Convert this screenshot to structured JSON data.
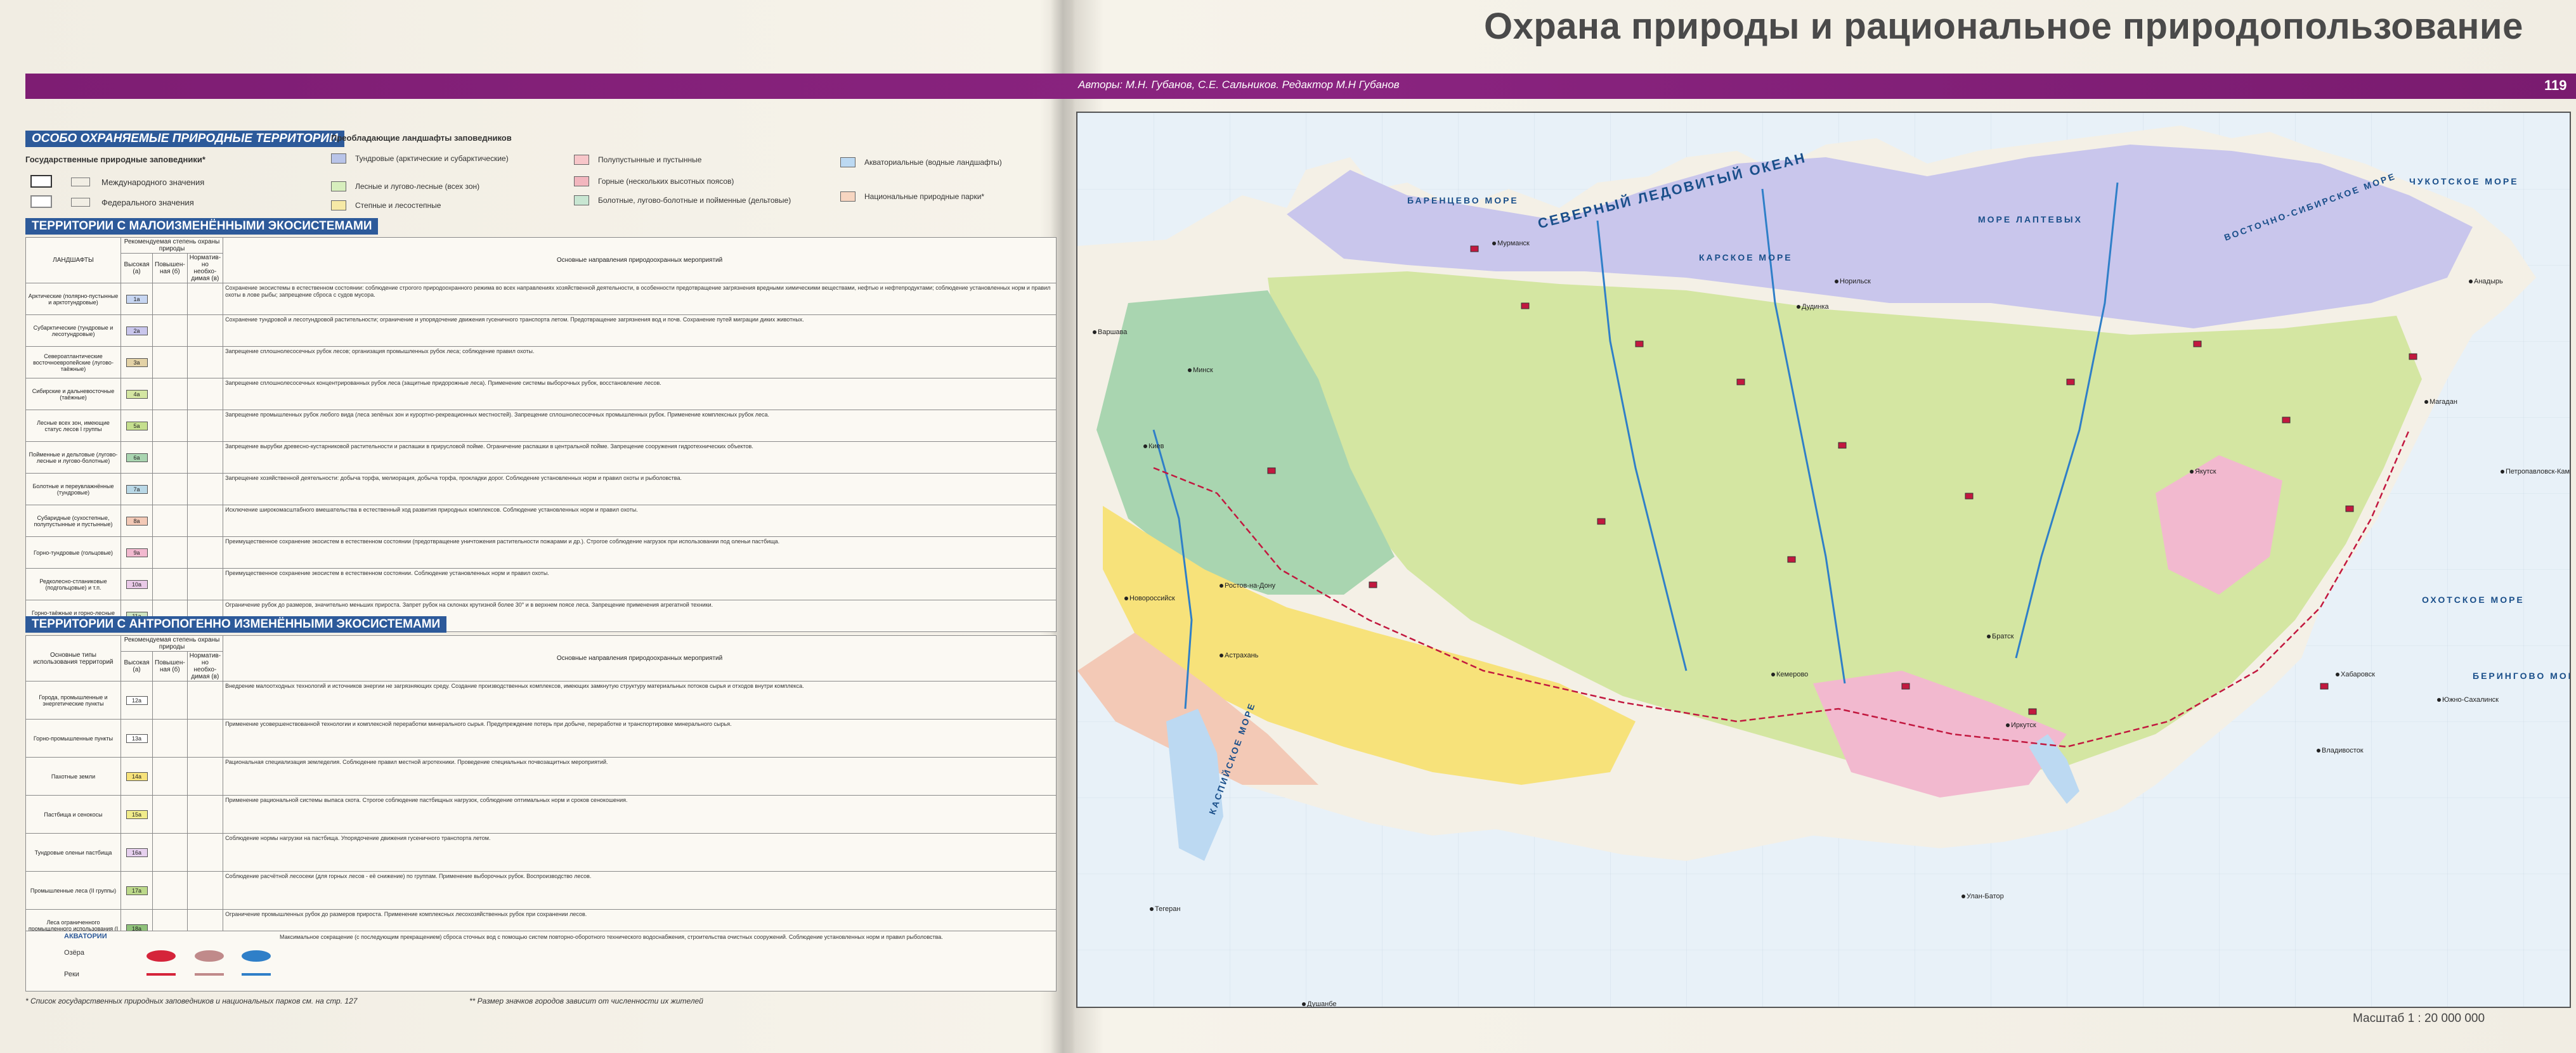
{
  "page": {
    "title": "Охрана природы и рациональное природопользование",
    "authors": "Авторы:  М.Н. Губанов, С.Е. Сальников.   Редактор  М.Н Губанов",
    "page_number": "119",
    "scale": "Масштаб   1 : 20 000 000"
  },
  "legend": {
    "sec_protected": "ОСОБО ОХРАНЯЕМЫЕ ПРИРОДНЫЕ ТЕРРИТОРИИ",
    "reserves_label": "Государственные природные заповедники*",
    "international": "Международного значения",
    "federal": "Федерального значения",
    "landscapes_head": "Преобладающие ландшафты заповедников",
    "landscape_items": [
      {
        "label": "Тундровые (арктические и субарктические)",
        "color": "#b9c4e8"
      },
      {
        "label": "Лесные и лугово-лесные (всех зон)",
        "color": "#d7eebd"
      },
      {
        "label": "Степные и лесостепные",
        "color": "#f6e9a6"
      },
      {
        "label": "Полупустынные и пустынные",
        "color": "#f7c6c9"
      },
      {
        "label": "Горные (нескольких высотных поясов)",
        "color": "#f2b6be"
      },
      {
        "label": "Болотные, лугово-болотные и пойменные (дельтовые)",
        "color": "#c8e6d2"
      },
      {
        "label": "Акваториальные (водные ландшафты)",
        "color": "#bcd9f2"
      },
      {
        "label": "Национальные природные парки*",
        "color": "#f7d6c1"
      }
    ],
    "sec_low": "ТЕРРИТОРИИ С МАЛОИЗМЕНЁННЫМИ ЭКОСИСТЕМАМИ",
    "t1_cols": [
      "ЛАНДШАФТЫ",
      "Рекомендуемая степень охраны природы",
      "Высокая (а)",
      "Повышен-ная (б)",
      "Норматив-но необхо-димая (в)",
      "Основные направления природоохранных мероприятий"
    ],
    "t1_rows": [
      {
        "name": "Арктические (полярно-пустынные и арктотундровые)",
        "code": "1а",
        "color": "#c7d6f2",
        "desc": "Сохранение экосистемы в естественном состоянии: соблюдение строгого природоохранного режима во всех направлениях хозяйственной деятельности, в особенности предотвращение загрязнения вредными химическими веществами, нефтью и нефтепродуктами; соблюдение установленных норм и правил охоты в лове рыбы; запрещение сброса с судов мусора."
      },
      {
        "name": "Субарктические (тундровые и лесотундровые)",
        "code": "2а",
        "color": "#c9c6ec",
        "desc": "Сохранение тундровой и лесотундровой растительности; ограничение и упорядочение движения гусеничного транспорта летом. Предотвращение загрязнения вод и почв. Сохранение путей миграции диких животных."
      },
      {
        "name": "Североатлантические восточноевропейские (лугово-таёжные)",
        "code": "3а",
        "color": "#e3d2a6",
        "desc": "Запрещение сплошнолесосечных рубок лесов; организация промышленных рубок леса; соблюдение правил охоты."
      },
      {
        "name": "Сибирские и дальневосточные (таёжные)",
        "code": "4а",
        "color": "#d4e6a2",
        "desc": "Запрещение сплошнолесосечных концентрированных рубок леса (защитные придорожные леса). Применение системы выборочных рубок, восстановление лесов."
      },
      {
        "name": "Лесные всех зон, имеющие статус лесов I группы",
        "code": "5а",
        "color": "#c5df8e",
        "desc": "Запрещение промышленных рубок любого вида (леса зелёных зон и курортно-рекреационных местностей). Запрещение сплошнолесосечных промышленных рубок. Применение комплексных рубок леса."
      },
      {
        "name": "Пойменные и дельтовые (лугово-лесные и лугово-болотные)",
        "code": "6а",
        "color": "#a9d5b0",
        "desc": "Запрещение вырубки древесно-кустарниковой растительности и распашки в прирусловой пойме. Ограничение распашки в центральной пойме. Запрещение сооружения гидротехнических объектов."
      },
      {
        "name": "Болотные и переувлажнённые (тундровые)",
        "code": "7а",
        "color": "#b9d8e6",
        "desc": "Запрещение хозяйственной деятельности: добыча торфа, мелиорация, добыча торфа, прокладки дорог. Соблюдение установленных норм и правил охоты и рыболовства."
      },
      {
        "name": "Субаридные (сухостепные, полупустынные и пустынные)",
        "code": "8а",
        "color": "#f3c9b6",
        "desc": "Исключение широкомасштабного вмешательства в естественный ход развития природных комплексов. Соблюдение установленных норм и правил охоты."
      },
      {
        "name": "Горно-тундровые (гольцовые)",
        "code": "9а",
        "color": "#f2b9cf",
        "desc": "Преимущественное сохранение экосистем в естественном состоянии (предотвращение уничтожения растительности пожарами и др.). Строгое соблюдение нагрузок при использовании под оленьи пастбища."
      },
      {
        "name": "Редколесно-стланиковые (подгольцовые) и т.п.",
        "code": "10а",
        "color": "#e9c9e7",
        "desc": "Преимущественное сохранение экосистем в естественном состоянии. Соблюдение установленных норм и правил охоты."
      },
      {
        "name": "Горно-таёжные и горно-лесные всех зон",
        "code": "11а",
        "color": "#cfe4bf",
        "desc": "Ограничение рубок до размеров, значительно меньших прироста. Запрет рубок на склонах крутизной более 30° и в верхнем поясе леса. Запрещение применения агрегатной техники."
      }
    ],
    "sec_anthro": "ТЕРРИТОРИИ С АНТРОПОГЕННО ИЗМЕНЁННЫМИ ЭКОСИСТЕМАМИ",
    "t2_cols": [
      "Основные типы использования территорий",
      "Рекомендуемая степень охраны природы",
      "Высокая (а)",
      "Повышен-ная (б)",
      "Норматив-но необхо-димая (в)",
      "Основные направления природоохранных мероприятий"
    ],
    "t2_rows": [
      {
        "name": "Города, промышленные и энергетические пункты",
        "code": "12а",
        "color": "#ffffff",
        "desc": "Внедрение малоотходных технологий и источников энергии не загрязняющих среду. Создание производственных комплексов, имеющих замкнутую структуру материальных потоков сырья и отходов внутри комплекса."
      },
      {
        "name": "Горно-промышленные пункты",
        "code": "13а",
        "color": "#ffffff",
        "desc": "Применение усовершенствованной технологии и комплексной переработки минерального сырья. Предупреждение потерь при добыче, переработке и транспортировке минерального сырья."
      },
      {
        "name": "Пахотные земли",
        "code": "14а",
        "color": "#f7e27a",
        "desc": "Рациональная специализация земледелия. Соблюдение правил местной агротехники. Проведение специальных почвозащитных мероприятий."
      },
      {
        "name": "Пастбища и сенокосы",
        "code": "15а",
        "color": "#f1ec8a",
        "desc": "Применение рациональной системы выпаса скота. Строгое соблюдение пастбищных нагрузок, соблюдение оптимальных норм и сроков сенокошения."
      },
      {
        "name": "Тундровые оленьи пастбища",
        "code": "16а",
        "color": "#e6d0ee",
        "desc": "Соблюдение нормы нагрузки на пастбища. Упорядочение движения гусеничного транспорта летом."
      },
      {
        "name": "Промышленные леса (II группы)",
        "code": "17а",
        "color": "#bcd98a",
        "desc": "Соблюдение расчётной лесосеки (для горных лесов - её снижение) по группам. Применение выборочных рубок. Воспроизводство лесов."
      },
      {
        "name": "Леса ограниченного промышленного использования (I группы)",
        "code": "18а",
        "color": "#8fc27a",
        "desc": "Ограничение промышленных рубок до размеров прироста. Применение комплексных лесохозяйственных рубок при сохранении лесов."
      }
    ],
    "aquatory_head": "АКВАТОРИИ",
    "lakes": "Озёра",
    "rivers": "Реки",
    "aqua_desc": "Максимальное сокращение (с последующим прекращением) сброса сточных вод с помощью систем повторно-оборотного технического водоснабжения, строительства очистных сооружений. Соблюдение установленных норм и правил рыболовства.",
    "footnote1": "* Список государственных природных заповедников и национальных парков см. на стр. 127",
    "footnote2": "** Размер значков городов зависит от численности их жителей"
  },
  "map": {
    "sea_labels": [
      "СЕВЕРНЫЙ  ЛЕДОВИТЫЙ  ОКЕАН",
      "ВОСТОЧНО-СИБИРСКОЕ  МОРЕ",
      "ЧУКОТСКОЕ  МОРЕ",
      "КАРСКОЕ  МОРЕ",
      "МОРЕ  ЛАПТЕВЫХ",
      "БАРЕНЦЕВО  МОРЕ",
      "ОХОТСКОЕ  МОРЕ",
      "КАСПИЙСКОЕ  МОРЕ",
      "БЕРИНГОВО  МОРЕ"
    ],
    "cities": [
      "Мурманск",
      "Варшава",
      "Минск",
      "Киев",
      "Ростов-на-Дону",
      "Новороссийск",
      "Астрахань",
      "Улан-Батор",
      "Тегеран",
      "Владивосток",
      "Хабаровск",
      "Южно-Сахалинск",
      "Петропавловск-Камчатский",
      "Магадан",
      "Анадырь",
      "Якутск",
      "Норильск",
      "Дудинка",
      "Братск",
      "Иркутск",
      "Душанбе",
      "Кемерово"
    ],
    "colors": {
      "sea": "#e8f1f8",
      "water": "#bcd9f2",
      "tundra": "#c9c6ec",
      "taiga": "#d4e6a2",
      "forest": "#a9d5b0",
      "steppe": "#f7e27a",
      "desert": "#f3c9b6",
      "mountain": "#f2b9cf",
      "land": "#f4f0e6"
    }
  }
}
